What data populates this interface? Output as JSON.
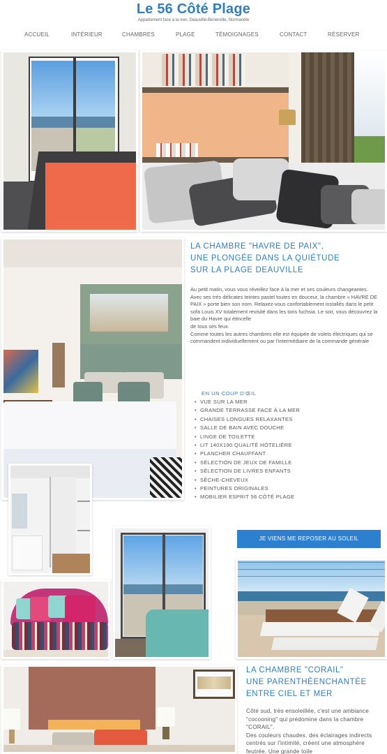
{
  "header": {
    "title": "Le 56 Côté Plage",
    "subtitle": "Appartement face à la mer, Deauville-Benerville, Normandie"
  },
  "nav": {
    "items": [
      "ACCUEIL",
      "INTÉRIEUR",
      "CHAMBRES",
      "PLAGE",
      "TÉMOIGNAGES",
      "CONTACT",
      "RÉSERVER"
    ]
  },
  "section1": {
    "title_lines": [
      "LA CHAMBRE \"HAVRE DE PAIX\",",
      "UNE PLONGÉE DANS LA QUIÉTUDE",
      "SUR LA PLAGE DEAUVILLE"
    ],
    "paragraphs": [
      "Au petit matin, vous vous réveillez face à la mer et ses couleurs changeantes.",
      "Avec ses très délicates teintes pastel toutes en douceur, la chambre « HAVRE DE PAIX » porte bien son nom. Relaxez-vous confortablement installés dans le petit sofa Louis XV totalement revisité dans les tons fuchsia. Le soir, vous découvrez la baie du Havre qui étincelle",
      "de tous ses feux.",
      "Comme toutes les autres chambres elle est équipée de volets électriques qui se commandent individuellement ou par l'intermédiaire de la commande générale"
    ],
    "features_title": "EN UN COUP D'ŒIL",
    "features": [
      "VUE SUR LA MER",
      "GRANDE TERRASSE FACE À LA MER",
      "CHAISES LONGUES RELAXANTES",
      "SALLE DE BAIN AVEC DOUCHE",
      "LINGE DE TOILETTE",
      "LIT 140X190 QUALITÉ HÔTELIÈRE",
      "PLANCHER CHAUFFANT",
      "SÉLECTION DE JEUX DE FAMILLE",
      "SÉLECTION DE LIVRES ENFANTS",
      "SÈCHE-CHEVEUX",
      "PEINTURES ORIGINALES",
      "MOBILIER ESPRIT 56 CÔTÉ PLAGE"
    ],
    "cta_label": "JE VIENS ME REPOSER AU SOLEIL"
  },
  "section2": {
    "title_lines": [
      "LA CHAMBRE \"CORAIL\"",
      "UNE PARENTHÈENCHANTÉE",
      "ENTRE CIEL ET MER"
    ],
    "paragraphs": [
      "Côté sud, très ensoleillée, c'est une ambiance \"cocooning\" qui prédomine dans la chambre \"CORAIL\".",
      "Des couleurs chaudes, des éclairages indirects centrés sur l'intimité, créent une atmosphère feutrée. Une grande toile"
    ]
  },
  "colors": {
    "accent": "#2e7fc2",
    "button": "#2d7fd0",
    "coral": "#ef6a4a",
    "sage": "#7f9a8c"
  }
}
